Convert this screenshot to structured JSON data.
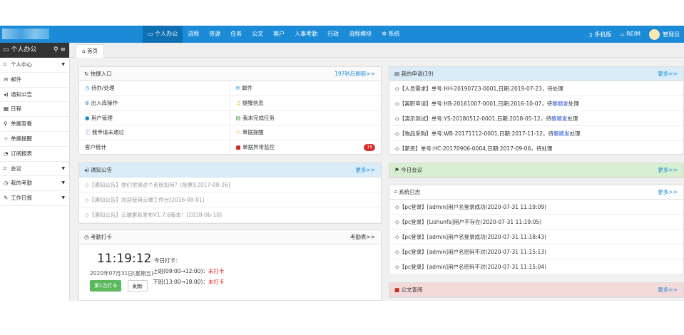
{
  "topbar": {
    "nav": [
      "个人办公",
      "流程",
      "资源",
      "任务",
      "公文",
      "客户",
      "人事考勤",
      "行政",
      "流程模块",
      "系统"
    ],
    "mobile": "手机版",
    "reim": "REIM",
    "user": "管理员"
  },
  "sidebar": {
    "title": "个人办公",
    "items": [
      {
        "label": "个人中心",
        "icon": "bookmark-icon",
        "caret": true
      },
      {
        "label": "邮件",
        "icon": "mail-icon",
        "caret": false
      },
      {
        "label": "通知公告",
        "icon": "speaker-icon",
        "caret": false
      },
      {
        "label": "日程",
        "icon": "calendar-icon",
        "caret": false
      },
      {
        "label": "单据查看",
        "icon": "search-icon",
        "caret": false
      },
      {
        "label": "单据提醒",
        "icon": "star-icon",
        "caret": false
      },
      {
        "label": "订阅报表",
        "icon": "rss-icon",
        "caret": false
      },
      {
        "label": "会议",
        "icon": "bookmark-icon",
        "caret": true
      },
      {
        "label": "我的考勤",
        "icon": "clock-icon",
        "caret": true
      },
      {
        "label": "工作日报",
        "icon": "edit-icon",
        "caret": true
      }
    ]
  },
  "tab": {
    "label": "首页"
  },
  "quick": {
    "title": "快捷入口",
    "refresh": "197秒后刷新>>",
    "items": [
      {
        "label": "待办/处理",
        "icon": "clock-icon"
      },
      {
        "label": "邮件",
        "icon": "mail-icon"
      },
      {
        "label": "出入库操作",
        "icon": "plus-circle-icon"
      },
      {
        "label": "提醒信息",
        "icon": "bell-icon"
      },
      {
        "label": "用户管理",
        "icon": "user-icon"
      },
      {
        "label": "我未完成任务",
        "icon": "task-icon"
      },
      {
        "label": "我申请未通过",
        "icon": "info-icon"
      },
      {
        "label": "单据提醒",
        "icon": "star-icon"
      },
      {
        "label": "客户统计",
        "icon": ""
      },
      {
        "label": "单据异常监控",
        "icon": "briefcase-icon",
        "badge": "15"
      }
    ]
  },
  "notice": {
    "title": "通知公告",
    "more": "更多>>",
    "items": [
      "【通知公告】你们觉得这个系统如何？(投票)[2017-08-26]",
      "【通知公告】欢迎使用云端工作台[2016-08-01]",
      "【通知公告】云端更新发布V1.7.6版本！[2018-06-10]"
    ]
  },
  "checkin": {
    "title": "考勤打卡",
    "link": "考勤表>>",
    "time": "11:19:12",
    "date": "2020年07月31日(星期五)",
    "today_label": "今日打卡：",
    "morning": "上班(09:00→12:00)：",
    "morning_status": "未打卡",
    "afternoon": "下班(13:00→18:00)：",
    "afternoon_status": "未打卡",
    "punch_button": "第1次打卡",
    "refresh_button": "刷新"
  },
  "myapply": {
    "title": "我的申请(19)",
    "more": "更多>>",
    "items": [
      {
        "text": "【人员需求】单号:HH-20190723-0001,日期:2019-07-23，待处理",
        "hl": ""
      },
      {
        "text": "【离职申请】单号:HB-20161007-0001,日期:2016-10-07，待",
        "hl": "黎顺发",
        "tail": "处理"
      },
      {
        "text": "【演示测试】单号:YS-20180512-0001,日期:2018-05-12，待",
        "hl": "黎顺发",
        "tail": "处理"
      },
      {
        "text": "【物品采购】单号:WB-20171112-0001,日期:2017-11-12，待",
        "hl": "黎顺发",
        "tail": "处理"
      },
      {
        "text": "【薪资】单号:HC-20170906-0004,日期:2017-09-06，待处理",
        "hl": ""
      }
    ]
  },
  "meeting": {
    "title": "今日会议",
    "more": "更多>>"
  },
  "syslog": {
    "title": "系统日志",
    "more": "更多>>",
    "items": [
      "【pc登录】[admin]用户名登录成功(2020-07-31 11:19:09)",
      "【pc登录】[Lishunfa]用户不存在(2020-07-31 11:19:05)",
      "【pc登录】[admin]用户名登录成功(2020-07-31 11:18:43)",
      "【pc登录】[admin]用户名密码不对(2020-07-31 11:15:13)",
      "【pc登录】[admin]用户名密码不对(2020-07-31 11:15:04)"
    ]
  },
  "docquery": {
    "title": "公文查阅",
    "more": "更多>>"
  }
}
